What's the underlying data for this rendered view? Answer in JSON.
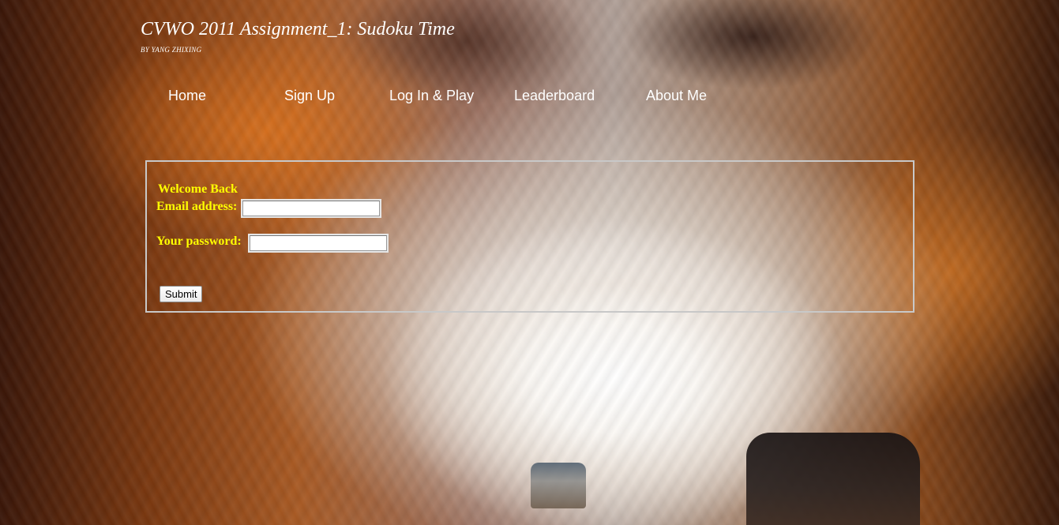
{
  "header": {
    "title": "CVWO 2011 Assignment_1: Sudoku Time",
    "byline": "BY YANG ZHIXING"
  },
  "nav": {
    "items": [
      {
        "label": "Home"
      },
      {
        "label": "Sign Up"
      },
      {
        "label": "Log In & Play"
      },
      {
        "label": "Leaderboard"
      },
      {
        "label": "About Me"
      }
    ]
  },
  "login": {
    "heading": "Welcome Back",
    "email_label": "Email address:",
    "email_value": "",
    "password_label": "Your password:",
    "password_value": "",
    "submit_label": "Submit"
  },
  "colors": {
    "label_text": "#ffff00",
    "nav_text": "#ffffff",
    "box_border": "#c8c8c8"
  }
}
